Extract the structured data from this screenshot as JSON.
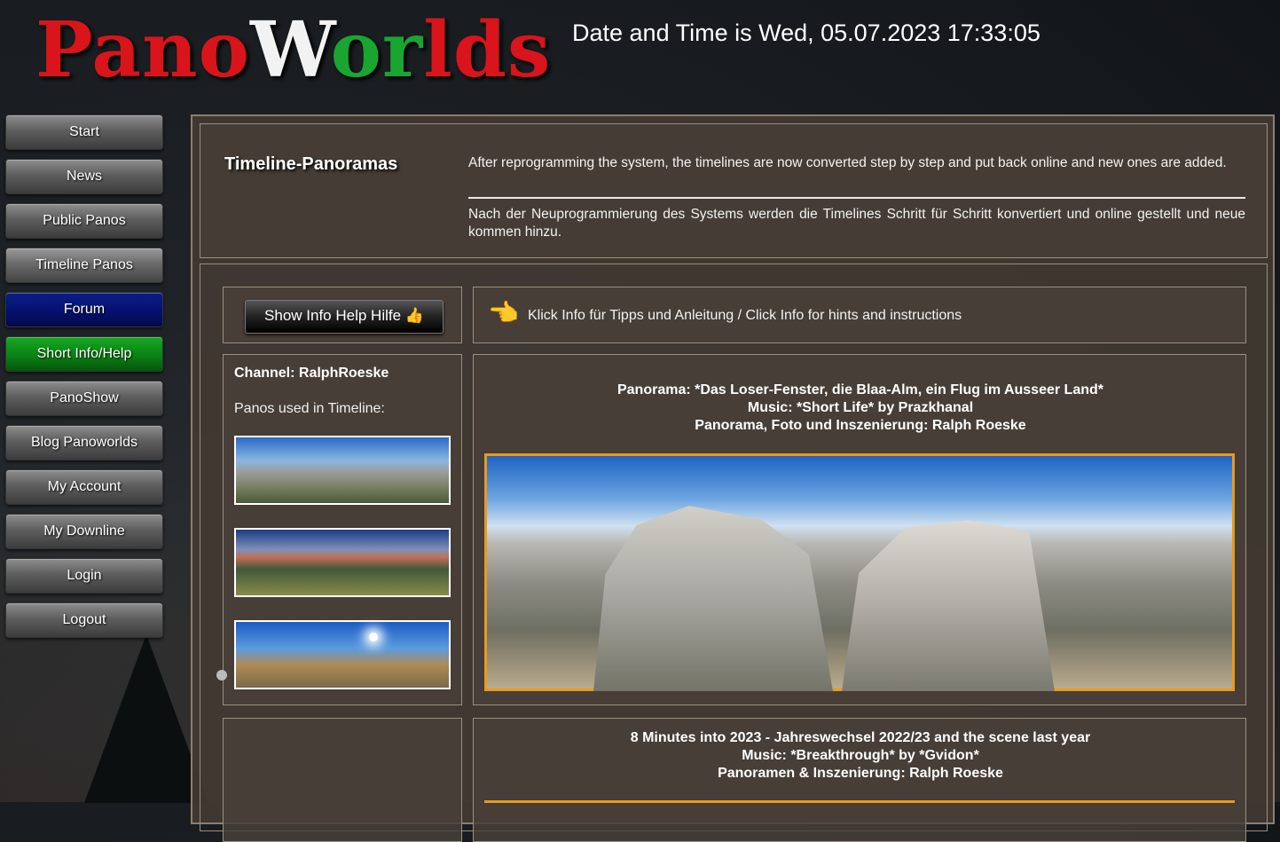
{
  "logo": {
    "part1": "Pano",
    "part2": "W",
    "part3": "or",
    "part4": "lds"
  },
  "datetime": "Date and Time is Wed, 05.07.2023 17:33:05",
  "nav": {
    "items": [
      {
        "label": "Start"
      },
      {
        "label": "News"
      },
      {
        "label": "Public Panos"
      },
      {
        "label": "Timeline Panos"
      },
      {
        "label": "Forum"
      },
      {
        "label": "Short Info/Help"
      },
      {
        "label": "PanoShow"
      },
      {
        "label": "Blog Panoworlds"
      },
      {
        "label": "My Account"
      },
      {
        "label": "My Downline"
      },
      {
        "label": "Login"
      },
      {
        "label": "Logout"
      }
    ]
  },
  "header": {
    "title": "Timeline-Panoramas",
    "text_en": "After reprogramming the system, the timelines are now converted step by step and put back online and new ones are added.",
    "text_de": "Nach der Neuprogrammierung des Systems werden die Timelines Schritt für Schritt konvertiert und online gestellt und neue kommen hinzu."
  },
  "info": {
    "button_label": "Show Info Help Hilfe 👍",
    "hint": "Klick Info für Tipps und Anleitung / Click Info for hints and instructions",
    "hand_icon": "👈"
  },
  "channel": {
    "label": "Channel: RalphRoeske",
    "panos_used": "Panos used in Timeline:"
  },
  "panorama1": {
    "line1": "Panorama: *Das Loser-Fenster, die Blaa-Alm, ein Flug im Ausseer Land*",
    "line2": "Music: *Short Life* by Prazkhanal",
    "line3": "Panorama, Foto und Inszenierung: Ralph Roeske"
  },
  "panorama2": {
    "line1": "8 Minutes into 2023 - Jahreswechsel 2022/23 and the scene last year",
    "line2": "Music: *Breakthrough* by *Gvidon*",
    "line3": "Panoramen & Inszenierung: Ralph Roeske"
  },
  "colors": {
    "forum": "#04106b",
    "help": "#0b7d14",
    "accent_border": "#e99a1d"
  }
}
